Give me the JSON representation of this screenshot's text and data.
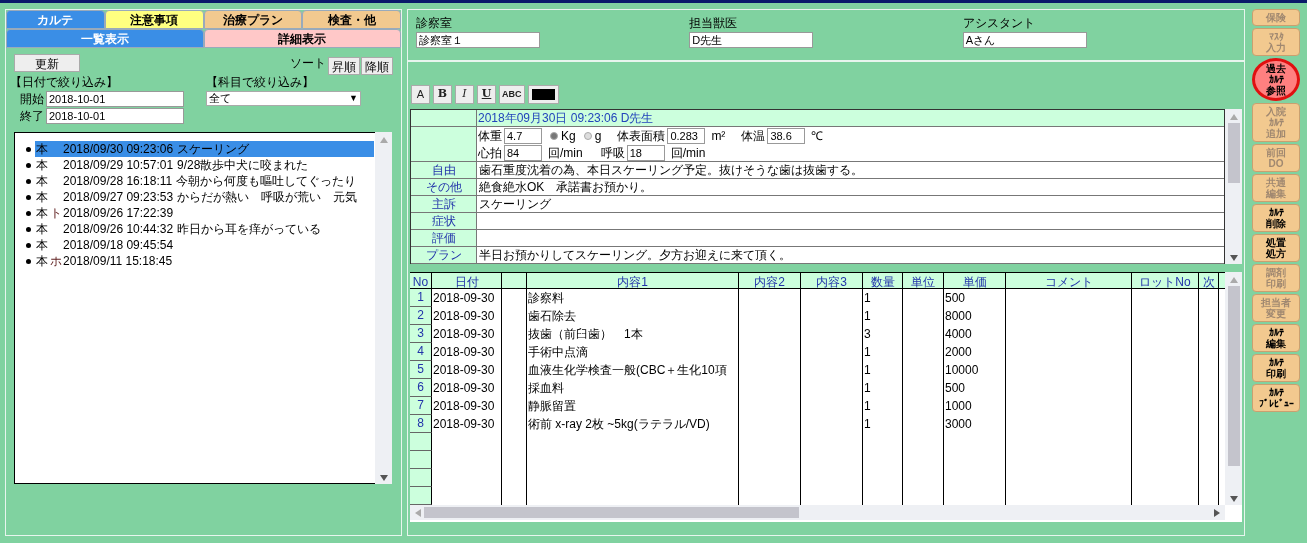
{
  "tabs_top": [
    {
      "label": "カルテ",
      "selected": true
    },
    {
      "label": "注意事項",
      "selected": false,
      "color": "#ffff80"
    },
    {
      "label": "治療プラン",
      "selected": false,
      "color": "#f2c98f"
    },
    {
      "label": "検査・他",
      "selected": false,
      "color": "#f2c98f"
    }
  ],
  "tabs_view": [
    {
      "label": "一覧表示",
      "selected": true
    },
    {
      "label": "詳細表示",
      "selected": false,
      "color": "#ffc8c8"
    }
  ],
  "refresh_button": "更新",
  "sort": {
    "label": "ソート",
    "buttons": [
      "昇順",
      "降順"
    ]
  },
  "date_filter": {
    "title": "【日付で絞り込み】",
    "start_label": "開始",
    "start": "2018-10-01",
    "end_label": "終了",
    "end": "2018-10-01"
  },
  "subject_filter": {
    "title": "【科目で絞り込み】",
    "value": "全て",
    "arrow": "▼"
  },
  "records": [
    {
      "type": "本",
      "datetime": "2018/09/30 09:23:06",
      "text": "スケーリング",
      "selected": true
    },
    {
      "type": "本",
      "datetime": "2018/09/29 10:57:01",
      "text": "9/28散歩中犬に咬まれた",
      "selected": false
    },
    {
      "type": "本",
      "datetime": "2018/09/28 16:18:11",
      "text": "今朝から何度も嘔吐してぐったり",
      "selected": false
    },
    {
      "type": "本",
      "datetime": "2018/09/27 09:23:53",
      "text": "からだが熱い　呼吸が荒い　元気",
      "selected": false
    },
    {
      "type": "本",
      "mark": "ト",
      "datetime": "2018/09/26 17:22:39",
      "selected": false
    },
    {
      "type": "本",
      "datetime": "2018/09/26 10:44:32",
      "text": "昨日から耳を痒がっている",
      "selected": false
    },
    {
      "type": "本",
      "datetime": "2018/09/18 09:45:54",
      "selected": false
    },
    {
      "type": "本",
      "mark": "ホ",
      "datetime": "2018/09/11 15:18:45",
      "selected": false
    }
  ],
  "staff": [
    {
      "label": "診察室",
      "value": "診察室１"
    },
    {
      "label": "担当獣医",
      "value": "D先生"
    },
    {
      "label": "アシスタント",
      "value": "Aさん"
    }
  ],
  "format_buttons": [
    {
      "label": "A",
      "kind": "plain"
    },
    {
      "label": "B",
      "kind": "bold"
    },
    {
      "label": "I",
      "kind": "italic"
    },
    {
      "label": "U",
      "kind": "underline"
    },
    {
      "label": "ABC",
      "kind": "small"
    }
  ],
  "record": {
    "header": "2018年09月30日 09:23:06 D先生",
    "vitals": {
      "weight_label": "体重",
      "weight": "4.7",
      "units": [
        {
          "label": "Kg",
          "selected": true
        },
        {
          "label": "g",
          "selected": false
        }
      ],
      "bsa_label": "体表面積",
      "bsa": "0.283",
      "bsa_unit": "m²",
      "temp_label": "体温",
      "temp": "38.6",
      "temp_unit": "℃",
      "pulse_label": "心拍",
      "pulse": "84",
      "pulse_unit": "回/min",
      "resp_label": "呼吸",
      "resp": "18",
      "resp_unit": "回/min"
    },
    "fields": [
      {
        "label": "自由",
        "value": "歯石重度沈着の為、本日スケーリング予定。抜けそうな歯は抜歯する。"
      },
      {
        "label": "その他",
        "value": "絶食絶水OK　承諾書お預かり。"
      },
      {
        "label": "主訴",
        "value": "スケーリング"
      },
      {
        "label": "症状"
      },
      {
        "label": "評価"
      },
      {
        "label": "プラン",
        "value": "半日お預かりしてスケーリング。夕方お迎えに来て頂く。"
      }
    ]
  },
  "billing": {
    "columns": [
      "No",
      "日付",
      null,
      "内容1",
      "内容2",
      "内容3",
      "数量",
      "単位",
      "単価",
      "コメント",
      "ロットNo",
      "次"
    ],
    "rows": [
      [
        "1",
        "2018-09-30",
        null,
        "診察料",
        null,
        null,
        "1",
        null,
        "500",
        null,
        null
      ],
      [
        "2",
        "2018-09-30",
        null,
        "歯石除去",
        null,
        null,
        "1",
        null,
        "8000",
        null,
        null
      ],
      [
        "3",
        "2018-09-30",
        null,
        "抜歯（前臼歯）　1本",
        null,
        null,
        "3",
        null,
        "4000",
        null,
        null
      ],
      [
        "4",
        "2018-09-30",
        null,
        "手術中点滴",
        null,
        null,
        "1",
        null,
        "2000",
        null,
        null
      ],
      [
        "5",
        "2018-09-30",
        null,
        "血液生化学検査一般(CBC＋生化10項",
        null,
        null,
        "1",
        null,
        "10000",
        null,
        null
      ],
      [
        "6",
        "2018-09-30",
        null,
        "採血料",
        null,
        null,
        "1",
        null,
        "500",
        null,
        null
      ],
      [
        "7",
        "2018-09-30",
        null,
        "静脈留置",
        null,
        null,
        "1",
        null,
        "1000",
        null,
        null
      ],
      [
        "8",
        "2018-09-30",
        null,
        "術前 x-ray 2枚 ~5kg(ラテラル/VD)",
        null,
        null,
        "1",
        null,
        "3000",
        null,
        null
      ]
    ]
  },
  "side_buttons": [
    {
      "lines": [
        "保険"
      ],
      "disabled": true,
      "highlighted": false
    },
    {
      "lines": [
        "ﾏｽﾀ",
        "入力"
      ],
      "disabled": true,
      "highlighted": false
    },
    {
      "lines": [
        "過去",
        "ｶﾙﾃ",
        "参照"
      ],
      "disabled": false,
      "highlighted": true
    },
    {
      "lines": [
        "入院",
        "ｶﾙﾃ",
        "追加"
      ],
      "disabled": true,
      "highlighted": false
    },
    {
      "lines": [
        "前回",
        "DO"
      ],
      "disabled": true,
      "highlighted": false
    },
    {
      "lines": [
        "共通",
        "編集"
      ],
      "disabled": true,
      "highlighted": false
    },
    {
      "lines": [
        "ｶﾙﾃ",
        "削除"
      ],
      "disabled": false,
      "highlighted": false
    },
    {
      "lines": [
        "処置",
        "処方"
      ],
      "disabled": false,
      "highlighted": false
    },
    {
      "lines": [
        "調剤",
        "印刷"
      ],
      "disabled": true,
      "highlighted": false
    },
    {
      "lines": [
        "担当者",
        "変更"
      ],
      "disabled": true,
      "highlighted": false
    },
    {
      "lines": [
        "ｶﾙﾃ",
        "編集"
      ],
      "disabled": false,
      "highlighted": false
    },
    {
      "lines": [
        "ｶﾙﾃ",
        "印刷"
      ],
      "disabled": false,
      "highlighted": false
    },
    {
      "lines": [
        "ｶﾙﾃ",
        "ﾌﾟﾚﾋﾞｭｰ"
      ],
      "disabled": false,
      "highlighted": false
    }
  ]
}
